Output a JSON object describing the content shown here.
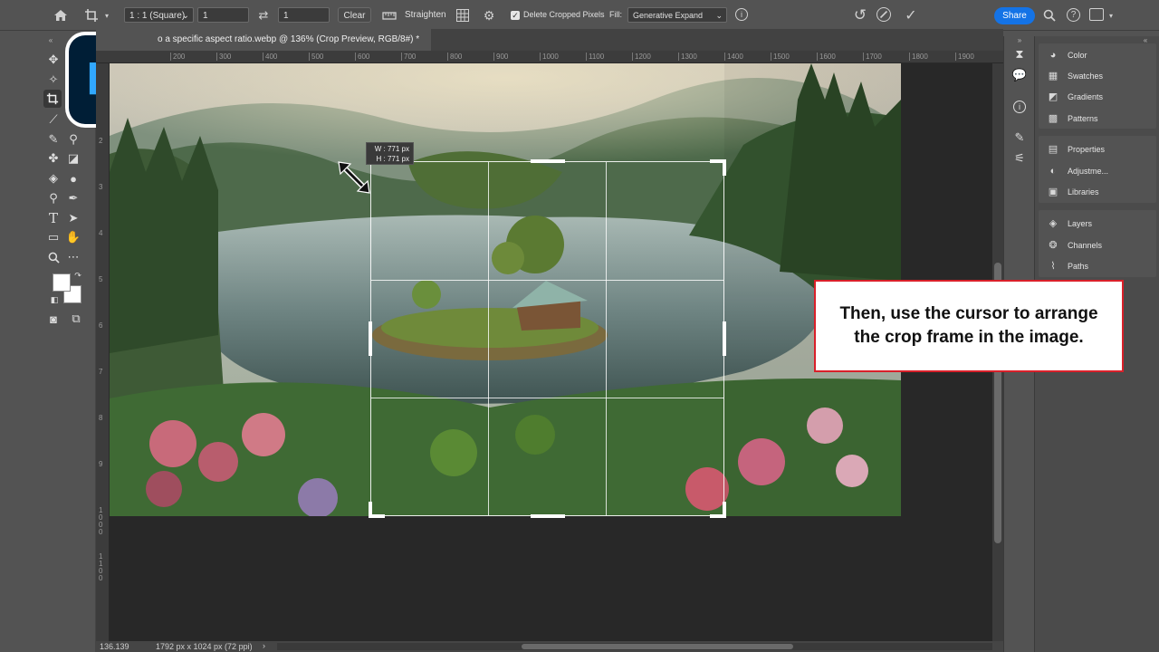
{
  "options_bar": {
    "ratio_select": "1 : 1 (Square)",
    "width_value": "1",
    "height_value": "1",
    "clear_label": "Clear",
    "straighten_label": "Straighten",
    "delete_cropped_label": "Delete Cropped Pixels",
    "delete_cropped_checked": true,
    "fill_label": "Fill:",
    "fill_select": "Generative Expand",
    "share_label": "Share"
  },
  "document": {
    "tab_title": "o a specific aspect ratio.webp @ 136% (Crop Preview, RGB/8#) *",
    "status_zoom": "136.139",
    "status_info": "1792 px x 1024 px (72 ppi)"
  },
  "ruler": {
    "top_ticks": [
      "200",
      "300",
      "400",
      "500",
      "600",
      "700",
      "800",
      "900",
      "1000",
      "1100",
      "1200",
      "1300",
      "1400",
      "1500",
      "1600",
      "1700",
      "1800",
      "1900"
    ],
    "left_ticks": [
      "2",
      "3",
      "4",
      "5",
      "6",
      "7",
      "8",
      "9",
      "1000",
      "1100"
    ]
  },
  "crop": {
    "width_readout": "W : 771 px",
    "height_readout": "H : 771 px"
  },
  "panels": {
    "group1": [
      "Color",
      "Swatches",
      "Gradients",
      "Patterns"
    ],
    "group2": [
      "Properties",
      "Adjustme...",
      "Libraries"
    ],
    "group3": [
      "Layers",
      "Channels",
      "Paths"
    ]
  },
  "logo": {
    "text": "Ps"
  },
  "callout": {
    "text": "Then, use the cursor to arrange the crop frame in the image."
  },
  "colors": {
    "share": "#1473e6",
    "callout_border": "#d9202a",
    "logo_bg": "#001e36",
    "logo_text": "#31a8ff"
  }
}
